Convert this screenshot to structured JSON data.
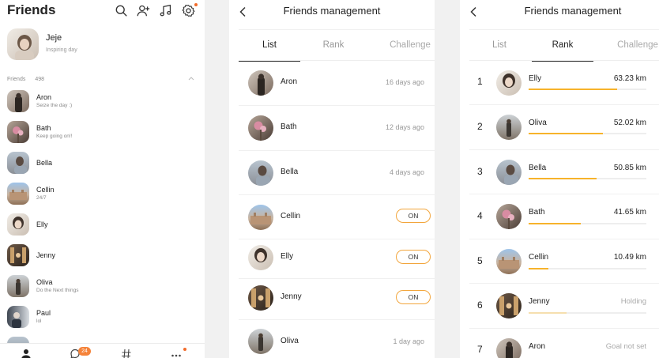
{
  "colors": {
    "accent": "#f7b32b",
    "badge": "#f5833a",
    "pill_border": "#f2a53b"
  },
  "friends_screen": {
    "title": "Friends",
    "header_icons": [
      "search-icon",
      "add-friend-icon",
      "music-icon",
      "settings-icon"
    ],
    "me": {
      "name": "Jeje",
      "status": "Inspiring day"
    },
    "section_label": "Friends",
    "section_count": "498",
    "friends": [
      {
        "name": "Aron",
        "status": "Seize the day :)"
      },
      {
        "name": "Bath",
        "status": "Keep going on!!"
      },
      {
        "name": "Bella",
        "status": ""
      },
      {
        "name": "Cellin",
        "status": "24/7"
      },
      {
        "name": "Elly",
        "status": ""
      },
      {
        "name": "Jenny",
        "status": ""
      },
      {
        "name": "Oliva",
        "status": "Do the Next things"
      },
      {
        "name": "Paul",
        "status": "lol"
      }
    ],
    "bottom_tabs": [
      "person-icon",
      "chat-icon",
      "hashtag-icon",
      "more-icon"
    ],
    "chat_badge": "24"
  },
  "management_list": {
    "title": "Friends management",
    "tabs": [
      "List",
      "Rank",
      "Challenge"
    ],
    "active_tab": "List",
    "rows": [
      {
        "name": "Aron",
        "time": "16 days ago"
      },
      {
        "name": "Bath",
        "time": "12 days ago"
      },
      {
        "name": "Bella",
        "time": "4 days ago"
      },
      {
        "name": "Cellin",
        "toggle": "ON"
      },
      {
        "name": "Elly",
        "toggle": "ON"
      },
      {
        "name": "Jenny",
        "toggle": "ON"
      },
      {
        "name": "Oliva",
        "time": "1 day ago"
      }
    ]
  },
  "management_rank": {
    "title": "Friends management",
    "tabs": [
      "List",
      "Rank",
      "Challenge"
    ],
    "active_tab": "Rank",
    "rows": [
      {
        "rank": "1",
        "name": "Elly",
        "distance": "63.23 km",
        "progress": 0.75
      },
      {
        "rank": "2",
        "name": "Oliva",
        "distance": "52.02 km",
        "progress": 0.63
      },
      {
        "rank": "3",
        "name": "Bella",
        "distance": "50.85 km",
        "progress": 0.58
      },
      {
        "rank": "4",
        "name": "Bath",
        "distance": "41.65 km",
        "progress": 0.44
      },
      {
        "rank": "5",
        "name": "Cellin",
        "distance": "10.49 km",
        "progress": 0.17
      },
      {
        "rank": "6",
        "name": "Jenny",
        "distance": "Holding",
        "progress": 0.32
      },
      {
        "rank": "7",
        "name": "Aron",
        "distance": "Goal not set",
        "progress": 0
      }
    ]
  }
}
